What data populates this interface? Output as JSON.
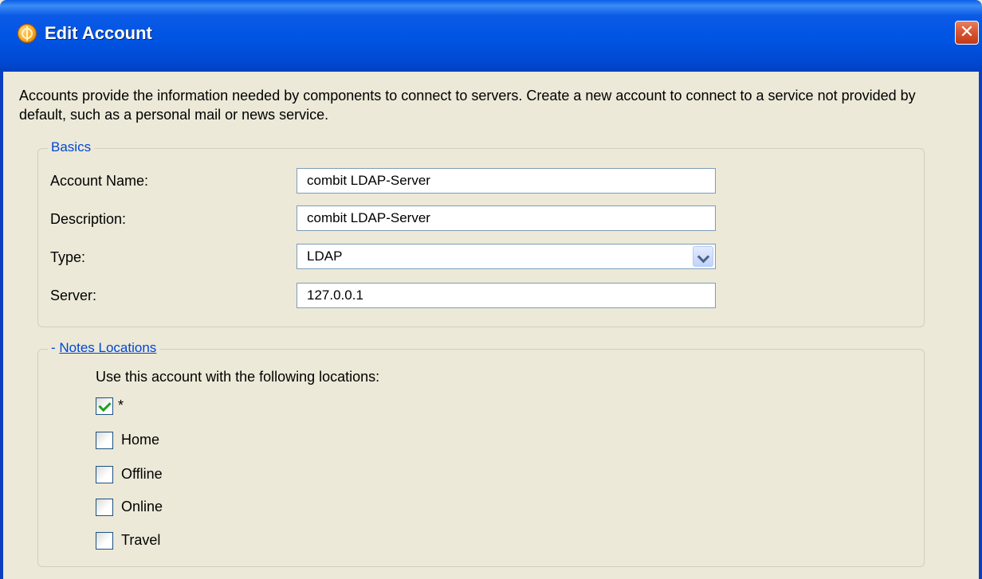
{
  "window": {
    "title": "Edit Account",
    "close_glyph": "✕"
  },
  "description": "Accounts provide the information needed by components to connect to servers. Create a new account to connect to a service not provided by default, such as a personal mail or news service.",
  "basics": {
    "legend": "Basics",
    "account_name_label": "Account Name:",
    "account_name_value": "combit LDAP-Server",
    "description_label": "Description:",
    "description_value": "combit LDAP-Server",
    "type_label": "Type:",
    "type_value": "LDAP",
    "server_label": "Server:",
    "server_value": "127.0.0.1"
  },
  "notes_locations": {
    "toggle": "- ",
    "legend": "Notes Locations",
    "caption": "Use this account with the following locations:",
    "locations": [
      {
        "label": "*",
        "checked": true
      },
      {
        "label": "Home",
        "checked": false
      },
      {
        "label": "Offline",
        "checked": false
      },
      {
        "label": "Online",
        "checked": false
      },
      {
        "label": "Travel",
        "checked": false
      }
    ]
  },
  "colors": {
    "titlebar": "#0054e3",
    "window_bg": "#ece9d8",
    "legend_text": "#0046d5",
    "check_mark": "#21a121"
  }
}
